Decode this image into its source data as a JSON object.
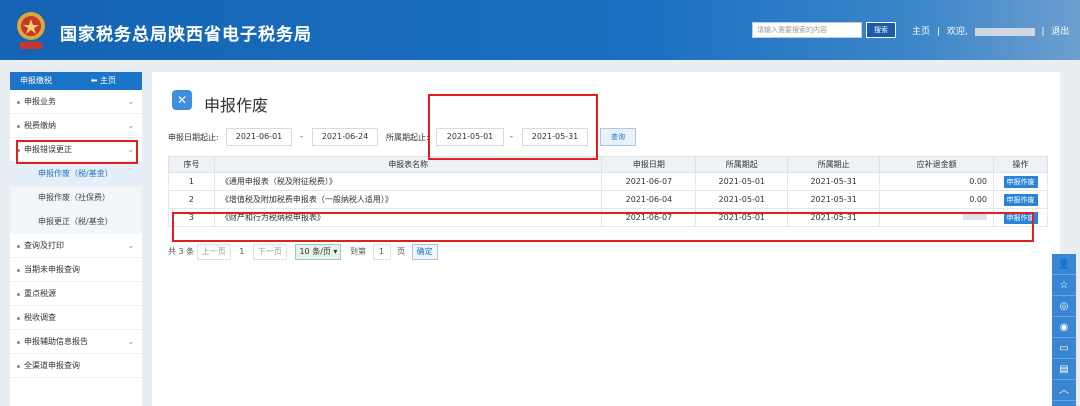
{
  "header": {
    "title": "国家税务总局陕西省电子税务局",
    "search_placeholder": "请输入需要搜索的内容",
    "search_button": "搜索",
    "home_link": "主页",
    "separator": "|",
    "welcome": "欢迎,",
    "logout": "退出",
    "colors": {
      "bar": "#1563b3",
      "accent": "#1b74c7"
    }
  },
  "sidebar": {
    "head_label": "申报缴税",
    "home_label": "主页",
    "items": [
      {
        "label": "申报业务",
        "chevron": "⌄"
      },
      {
        "label": "税费缴纳",
        "chevron": "⌄"
      },
      {
        "label": "申报错误更正",
        "chevron": "⌄"
      }
    ],
    "subitems": [
      {
        "label": "申报作废（税/基金）"
      },
      {
        "label": "申报作废（社保费）"
      },
      {
        "label": "申报更正（税/基金）"
      }
    ],
    "more_items": [
      {
        "label": "查询及打印",
        "chevron": "⌄"
      },
      {
        "label": "当期未申报查询",
        "chevron": ""
      },
      {
        "label": "重点税源",
        "chevron": ""
      },
      {
        "label": "税收调查",
        "chevron": ""
      },
      {
        "label": "申报辅助信息报告",
        "chevron": "⌄"
      },
      {
        "label": "全渠道申报查询",
        "chevron": ""
      }
    ]
  },
  "main": {
    "title": "申报作废",
    "filter": {
      "date_from_label": "申报日期起止:",
      "date_from": "2021-06-01",
      "dash": "-",
      "date_to": "2021-06-24",
      "period_label": "所属期起止:",
      "period_from": "2021-05-01",
      "period_to": "2021-05-31",
      "query_button": "查询"
    },
    "table": {
      "headers": [
        "序号",
        "申报表名称",
        "申报日期",
        "所属期起",
        "所属期止",
        "应补退金额",
        "操作"
      ],
      "rows": [
        {
          "no": "1",
          "name": "《通用申报表（税及附征税费）》",
          "date": "2021-06-07",
          "start": "2021-05-01",
          "end": "2021-05-31",
          "amount": "0.00",
          "action": "申报作废"
        },
        {
          "no": "2",
          "name": "《增值税及附加税费申报表（一般纳税人适用）》",
          "date": "2021-06-04",
          "start": "2021-05-01",
          "end": "2021-05-31",
          "amount": "0.00",
          "action": "申报作废"
        },
        {
          "no": "3",
          "name": "《财产和行为税纳税申报表》",
          "date": "2021-06-07",
          "start": "2021-05-01",
          "end": "2021-05-31",
          "amount": "",
          "action": "申报作废"
        }
      ]
    },
    "pager": {
      "total": "共 3 条",
      "prev": "上一页",
      "current": "1",
      "next": "下一页",
      "page_size": "10 条/页",
      "goto_label": "到第",
      "goto_value": "1",
      "page_unit": "页",
      "confirm": "确定"
    }
  }
}
